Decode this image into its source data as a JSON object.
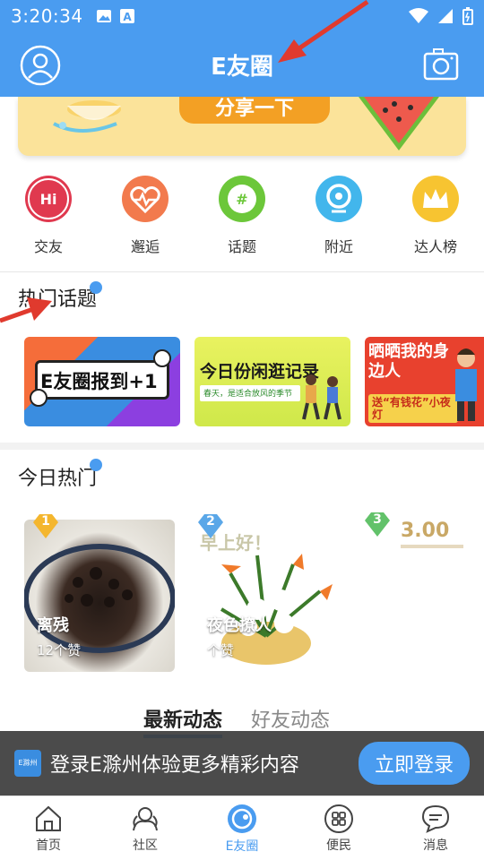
{
  "status_bar": {
    "time": "3:20:34"
  },
  "header": {
    "title": "E友圈"
  },
  "banner": {
    "share_label": "分享一下"
  },
  "categories": [
    {
      "label": "交友",
      "icon": "hi-icon",
      "color": "#e0394f"
    },
    {
      "label": "邂逅",
      "icon": "heart-pulse-icon",
      "color": "#f27a4d"
    },
    {
      "label": "话题",
      "icon": "hashtag-icon",
      "color": "#6cc73a"
    },
    {
      "label": "附近",
      "icon": "location-icon",
      "color": "#42b6ec"
    },
    {
      "label": "达人榜",
      "icon": "crown-icon",
      "color": "#f7c431"
    }
  ],
  "hot_topics": {
    "title": "热门话题",
    "cards": [
      {
        "text": "E友圈报到+1"
      },
      {
        "text": "今日份闲逛记录",
        "subtext": "春天，是适合放风的季节"
      },
      {
        "text": "晒晒我的身边人",
        "subtext": "送“有钱花”小夜灯"
      }
    ]
  },
  "today_hot": {
    "title": "今日热门",
    "items": [
      {
        "rank": "1",
        "caption": "离残",
        "likes": "12个赞"
      },
      {
        "rank": "2",
        "caption": "夜色撩人",
        "likes": "个赞",
        "overlay": "早上好！"
      },
      {
        "rank": "3",
        "amount": "3.00"
      }
    ]
  },
  "feed_tabs": {
    "latest": "最新动态",
    "friends": "好友动态"
  },
  "login_bar": {
    "logo_text": "E滁州",
    "prompt": "登录E滁州体验更多精彩内容",
    "button": "立即登录"
  },
  "bottom_nav": [
    {
      "label": "首页",
      "icon": "home-icon"
    },
    {
      "label": "社区",
      "icon": "community-icon"
    },
    {
      "label": "E友圈",
      "icon": "e-circle-icon"
    },
    {
      "label": "便民",
      "icon": "grid-icon"
    },
    {
      "label": "消息",
      "icon": "message-icon"
    }
  ]
}
